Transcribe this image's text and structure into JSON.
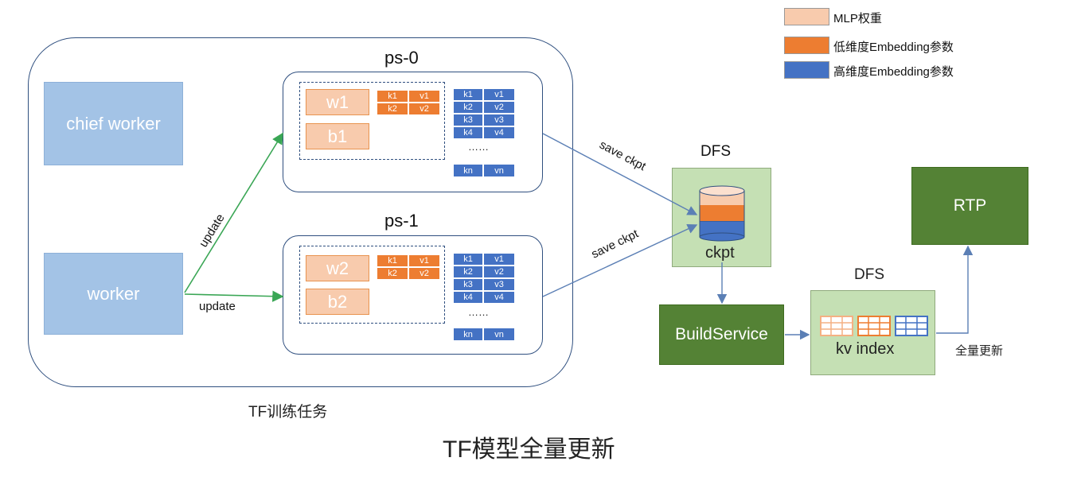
{
  "legend": {
    "items": [
      {
        "label": "MLP权重",
        "color": "#f8cbad"
      },
      {
        "label": "低维度Embedding参数",
        "color": "#ed7d31"
      },
      {
        "label": "高维度Embedding参数",
        "color": "#4472c4"
      }
    ]
  },
  "training": {
    "title": "TF训练任务",
    "chief_worker": "chief worker",
    "worker": "worker",
    "update_top": "update",
    "update_bottom": "update"
  },
  "ps": [
    {
      "name": "ps-0",
      "weight": "w1",
      "bias": "b1",
      "low_dim": [
        [
          "k1",
          "v1"
        ],
        [
          "k2",
          "v2"
        ]
      ],
      "high_dim": [
        [
          "k1",
          "v1"
        ],
        [
          "k2",
          "v2"
        ],
        [
          "k3",
          "v3"
        ],
        [
          "k4",
          "v4"
        ]
      ],
      "ellipsis": "……",
      "last_row": [
        "kn",
        "vn"
      ]
    },
    {
      "name": "ps-1",
      "weight": "w2",
      "bias": "b2",
      "low_dim": [
        [
          "k1",
          "v1"
        ],
        [
          "k2",
          "v2"
        ]
      ],
      "high_dim": [
        [
          "k1",
          "v1"
        ],
        [
          "k2",
          "v2"
        ],
        [
          "k3",
          "v3"
        ],
        [
          "k4",
          "v4"
        ]
      ],
      "ellipsis": "……",
      "last_row": [
        "kn",
        "vn"
      ]
    }
  ],
  "save_ckpt_top": "save ckpt",
  "save_ckpt_bottom": "save ckpt",
  "dfs_ckpt": {
    "title": "DFS",
    "label": "ckpt"
  },
  "build_service": "BuildService",
  "dfs_kv": {
    "title": "DFS",
    "label": "kv index"
  },
  "rtp": "RTP",
  "full_update": "全量更新",
  "caption": "TF模型全量更新",
  "colors": {
    "border": "#2f4f7f",
    "arrow_green": "#3aa655",
    "arrow_blue": "#5b7fb5",
    "mlp": "#f8cbad",
    "low_dim": "#ed7d31",
    "high_dim": "#4472c4"
  }
}
